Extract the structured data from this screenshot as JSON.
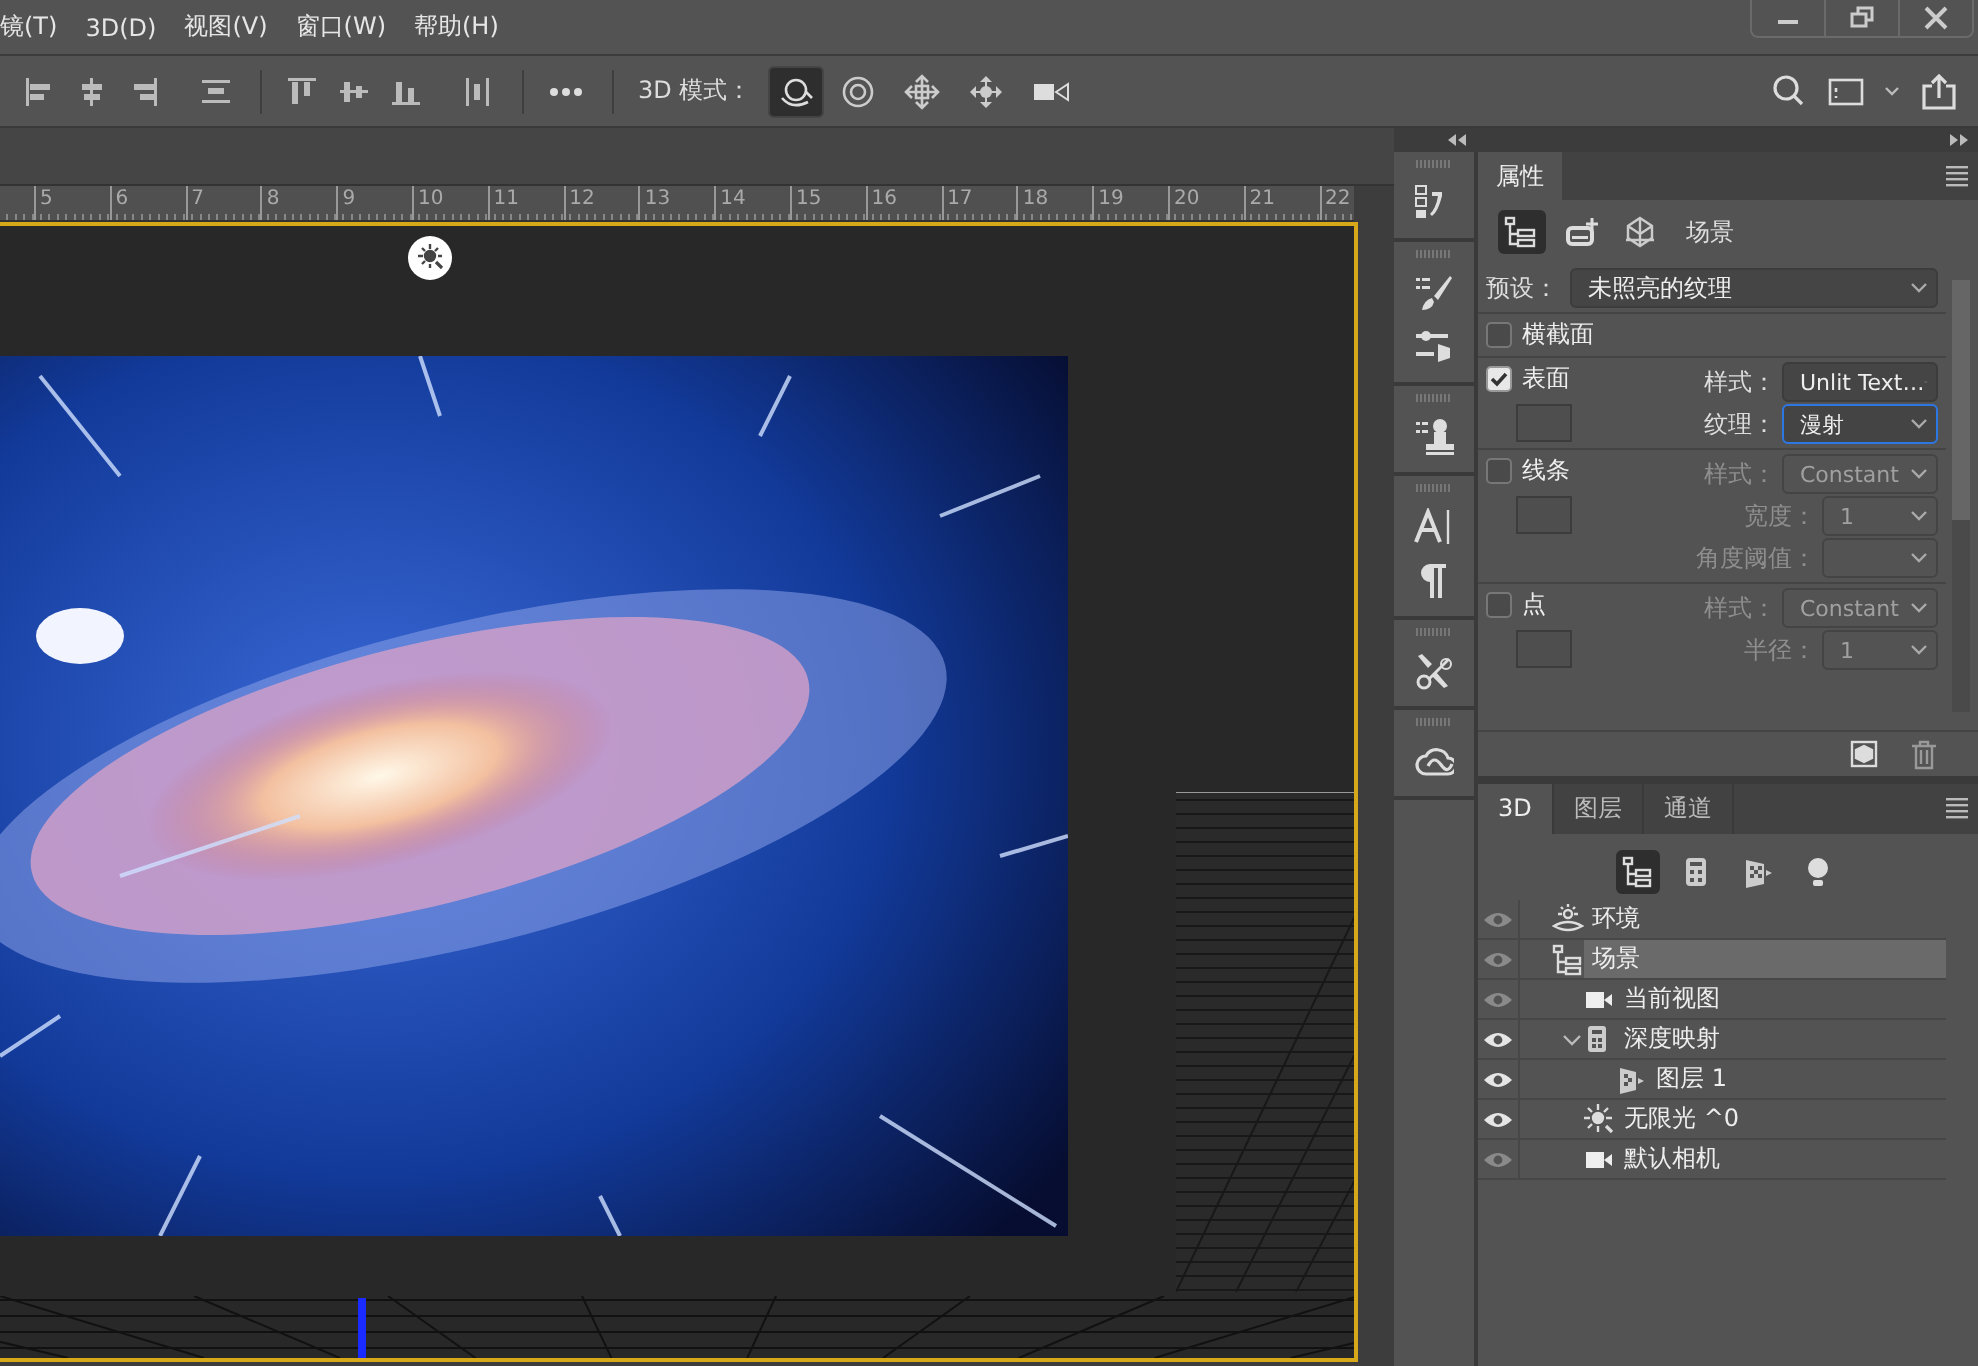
{
  "menu": [
    {
      "label": "镜(T)"
    },
    {
      "label": "3D(D)"
    },
    {
      "label": "视图(V)"
    },
    {
      "label": "窗口(W)"
    },
    {
      "label": "帮助(H)"
    }
  ],
  "options_bar": {
    "mode_label": "3D 模式：",
    "modes": [
      {
        "selected": true
      },
      {
        "selected": false
      },
      {
        "selected": false
      },
      {
        "selected": false
      },
      {
        "selected": false
      }
    ]
  },
  "ruler": [
    "5",
    "6",
    "7",
    "8",
    "9",
    "10",
    "11",
    "12",
    "13",
    "14",
    "15",
    "16",
    "17",
    "18",
    "19",
    "20",
    "21",
    "22"
  ],
  "properties": {
    "title": "属性",
    "views": [
      {
        "selected": true
      },
      {
        "selected": false
      },
      {
        "selected": false
      }
    ],
    "view_title": "场景",
    "preset": {
      "label": "预设：",
      "value": "未照亮的纹理"
    },
    "sections": [
      {
        "kind": "plain",
        "label": "横截面",
        "checked": false
      },
      {
        "kind": "swatch",
        "label": "表面",
        "checked": true,
        "fields": [
          {
            "kind": "wide",
            "label": "样式：",
            "value": "Unlit Text…",
            "disabled": false,
            "focused": false
          },
          {
            "kind": "wide",
            "label": "纹理：",
            "value": "漫射",
            "disabled": false,
            "focused": true
          }
        ]
      },
      {
        "kind": "swatch",
        "label": "线条",
        "checked": false,
        "fields": [
          {
            "kind": "wide",
            "label": "样式：",
            "value": "Constant",
            "disabled": true,
            "focused": false
          },
          {
            "kind": "narrow",
            "label": "宽度：",
            "value": "1",
            "disabled": true,
            "focused": false
          },
          {
            "kind": "narrow",
            "label": "角度阈值：",
            "disabled": true,
            "focused": false
          }
        ]
      },
      {
        "kind": "swatch",
        "label": "点",
        "checked": false,
        "fields": [
          {
            "kind": "wide",
            "label": "样式：",
            "value": "Constant",
            "disabled": true,
            "focused": false
          },
          {
            "kind": "narrow",
            "label": "半径：",
            "value": "1",
            "disabled": true,
            "focused": false
          }
        ]
      }
    ]
  },
  "layers_panel": {
    "tabs": [
      {
        "label": "3D",
        "selected": true
      },
      {
        "label": "图层",
        "selected": false
      },
      {
        "label": "通道",
        "selected": false
      }
    ],
    "filters": [
      {
        "selected": true
      },
      {
        "selected": false
      },
      {
        "selected": false
      },
      {
        "selected": false
      }
    ],
    "items": [
      {
        "kind": "environment",
        "label": "环境",
        "visible": false,
        "selected": false
      },
      {
        "kind": "scene",
        "label": "场景",
        "visible": false,
        "selected": true,
        "children": [
          {
            "kind": "camera",
            "label": "当前视图",
            "visible": false,
            "selected": false
          },
          {
            "kind": "mesh",
            "label": "深度映射",
            "visible": true,
            "selected": false,
            "expanded": true,
            "children": [
              {
                "kind": "material",
                "label": "图层 1",
                "visible": true,
                "selected": false
              }
            ]
          },
          {
            "kind": "light",
            "label": "无限光 ^0",
            "visible": true,
            "selected": false
          },
          {
            "kind": "camera",
            "label": "默认相机",
            "visible": false,
            "selected": false
          }
        ]
      }
    ]
  }
}
